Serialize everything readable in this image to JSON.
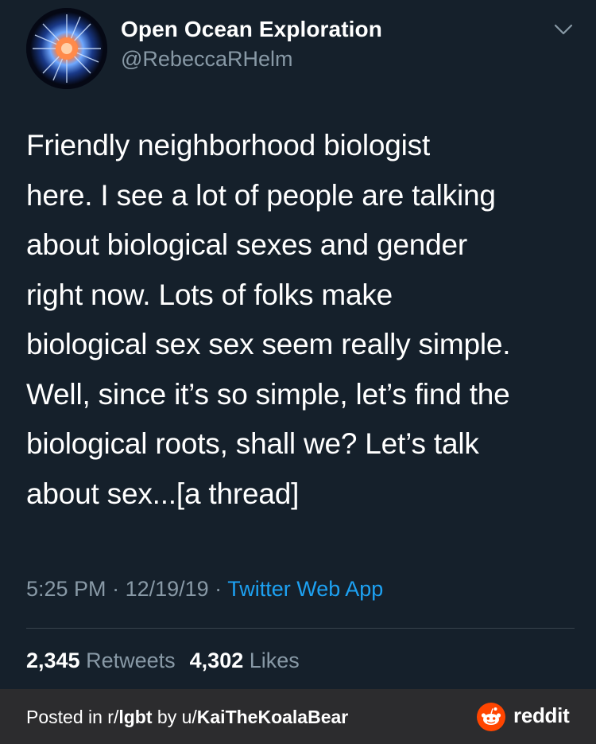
{
  "tweet": {
    "display_name": "Open Ocean Exploration",
    "handle": "@RebeccaRHelm",
    "text": "Friendly neighborhood biologist\nhere. I see a lot of people are talking\nabout biological sexes and gender\nright now. Lots of folks make\nbiological sex sex seem really simple.\nWell, since it’s so simple, let’s find the\nbiological roots, shall we?  Let’s talk\nabout sex...[a thread]",
    "time": "5:25 PM",
    "sep1": " · ",
    "date": "12/19/19",
    "sep2": " · ",
    "source": "Twitter Web App",
    "retweet_count": "2,345",
    "retweet_label": "Retweets",
    "like_count": "4,302",
    "like_label": "Likes",
    "avatar_icon": "jellyfish-avatar-icon",
    "menu_icon": "chevron-down-icon"
  },
  "footer": {
    "posted_prefix": "Posted in ",
    "subreddit_prefix": "r/",
    "subreddit": "lgbt",
    "by_text": " by ",
    "user_prefix": "u/",
    "username": "KaiTheKoalaBear",
    "brand": "reddit",
    "brand_color": "#ff4500"
  },
  "colors": {
    "background": "#15202b",
    "secondary_text": "#8899a6",
    "link": "#1da1f2",
    "footer_bg": "#2c2c2e"
  }
}
